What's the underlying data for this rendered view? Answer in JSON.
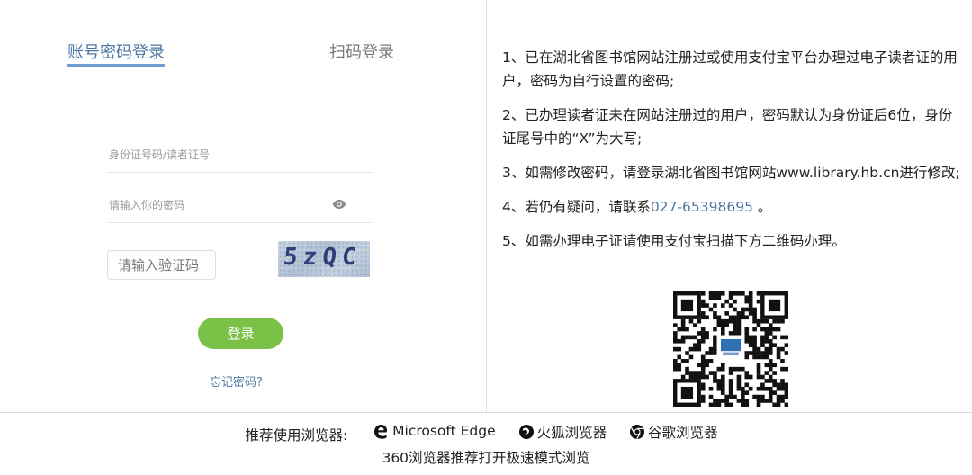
{
  "login": {
    "tab_account": "账号密码登录",
    "tab_qr": "扫码登录",
    "id_placeholder": "身份证号码/读者证号",
    "password_placeholder": "请输入你的密码",
    "captcha_placeholder": "请输入验证码",
    "captcha_text": "5zQC",
    "login_button": "登录",
    "forgot_link": "忘记密码?"
  },
  "info": {
    "items": [
      "1、已在湖北省图书馆网站注册过或使用支付宝平台办理过电子读者证的用户，密码为自行设置的密码;",
      "2、已办理读者证未在网站注册过的用户，密码默认为身份证后6位，身份证尾号中的“X”为大写;",
      "3、如需修改密码，请登录湖北省图书馆网站www.library.hb.cn进行修改;",
      "5、如需办理电子证请使用支付宝扫描下方二维码办理。"
    ],
    "contact_prefix": "4、若仍有疑问，请联系",
    "phone": "027-65398695",
    "contact_suffix": " 。"
  },
  "footer": {
    "recommend_label": "推荐使用浏览器:",
    "browsers": [
      "Microsoft Edge",
      "火狐浏览器",
      "谷歌浏览器"
    ],
    "note": "360浏览器推荐打开极速模式浏览"
  },
  "colors": {
    "accent": "#4e78a4",
    "login_button": "#7bc148",
    "underline": "#6fa0d0"
  }
}
